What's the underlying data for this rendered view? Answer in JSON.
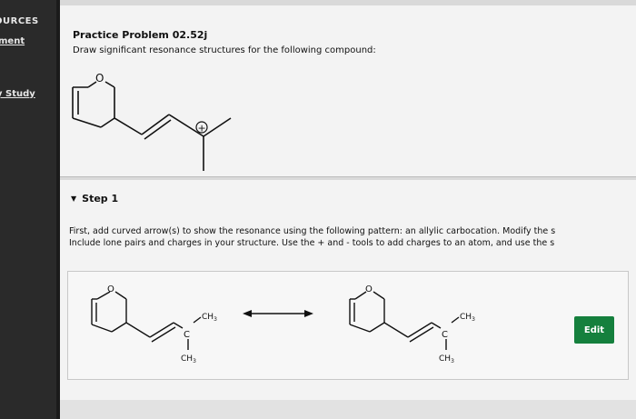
{
  "sidebar": {
    "heading": "OURCES",
    "link_top": "ment",
    "link_study": "y Study"
  },
  "problem": {
    "title": "Practice Problem 02.52j",
    "text": "Draw significant resonance structures for the following compound:"
  },
  "molecule_top": {
    "ring_oxygen": "O",
    "charge": "+"
  },
  "step": {
    "label": "Step 1",
    "line1": "First, add curved arrow(s) to show the resonance using the following pattern: an allylic carbocation. Modify the s",
    "line2": "Include lone pairs and charges in your structure. Use the + and - tools to add charges to an atom, and use the s"
  },
  "structures": {
    "left": {
      "oxygen": "O",
      "carbon": "C",
      "methyl_right": "CH",
      "methyl_right_sub": "3",
      "methyl_down": "CH",
      "methyl_down_sub": "3"
    },
    "right": {
      "oxygen": "O",
      "carbon": "C",
      "methyl_right": "CH",
      "methyl_right_sub": "3",
      "methyl_down": "CH",
      "methyl_down_sub": "3"
    }
  },
  "edit_button": "Edit",
  "colors": {
    "edit_button": "#15803d",
    "panel": "#f3f3f3"
  }
}
